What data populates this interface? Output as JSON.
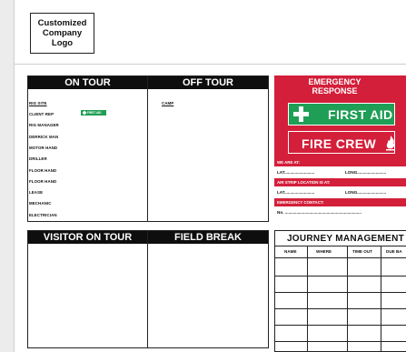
{
  "logo": {
    "text": "Customized\nCompany\nLogo"
  },
  "on_tour": {
    "title": "ON TOUR",
    "items": [
      "RIG SITE",
      "CLIENT REP",
      "RIG MANAGER",
      "DERRICK MAN",
      "MOTOR HAND",
      "DRILLER",
      "FLOOR HAND",
      "FLOOR HAND",
      "LEASE",
      "MECHANIC",
      "ELECTRICIAN"
    ],
    "badge": "FIRST AID"
  },
  "off_tour": {
    "title": "OFF TOUR",
    "items": [
      "CAMP"
    ]
  },
  "visitor_on_tour": {
    "title": "VISITOR ON TOUR"
  },
  "field_break": {
    "title": "FIELD BREAK"
  },
  "emergency": {
    "title_line1": "EMERGENCY",
    "title_line2": "RESPONSE",
    "first_aid": "FIRST AID",
    "fire_crew": "FIRE CREW",
    "we_are_at": "WE ARE AT:",
    "lat1": "LAT..........................",
    "long1": "LONG.........................",
    "air_strip": "AIR STRIP LOCATION IS AT:",
    "lat2": "LAT..........................",
    "long2": "LONG.........................",
    "contact": "EMERGENCY CONTACT:",
    "no": "No. ..................................................................",
    "colors": {
      "red": "#d31f3a",
      "green": "#1f9e55"
    }
  },
  "journey": {
    "title": "JOURNEY MANAGEMENT",
    "columns": [
      "NAME",
      "WHERE",
      "TIME OUT",
      "DUE BA"
    ]
  }
}
